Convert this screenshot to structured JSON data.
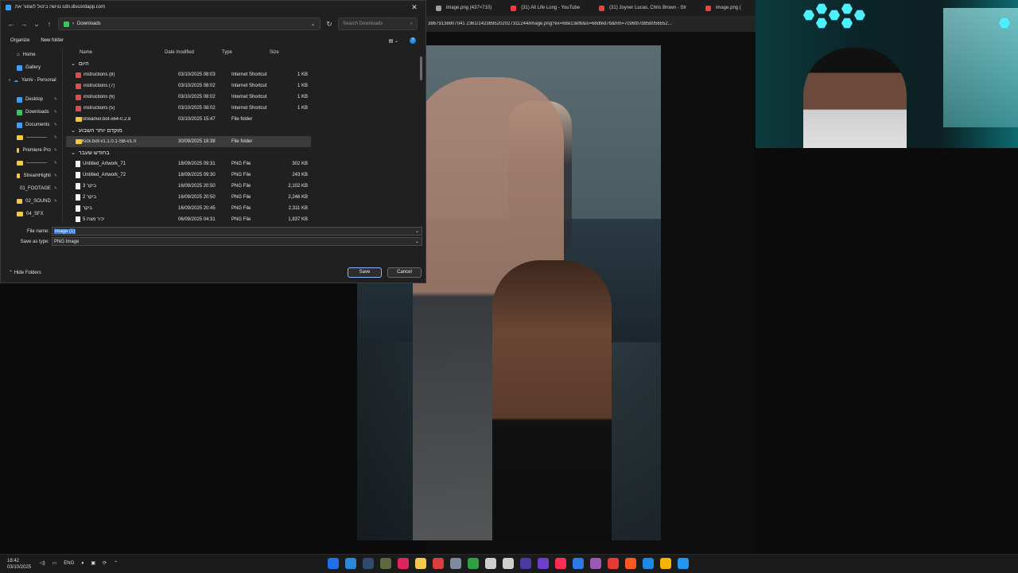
{
  "dialog": {
    "title": "נגישה ביטול לשמור את cdn.discordapp.com",
    "path": "Downloads",
    "search_placeholder": "Search Downloads",
    "toolbar": {
      "organize": "Organize",
      "new_folder": "New folder"
    },
    "columns": {
      "name": "Name",
      "date": "Date modified",
      "type": "Type",
      "size": "Size"
    },
    "sidebar": [
      {
        "label": "Home"
      },
      {
        "label": "Gallery"
      },
      {
        "label": "Yaniv - Personal"
      },
      {
        "label": "Desktop"
      },
      {
        "label": "Downloads"
      },
      {
        "label": "Documents"
      },
      {
        "label": "-------------"
      },
      {
        "label": "Premiere Pro"
      },
      {
        "label": "-------------"
      },
      {
        "label": "StreamHighli"
      },
      {
        "label": "01_FOOTAGE"
      },
      {
        "label": "02_SOUND"
      },
      {
        "label": "04_SFX"
      }
    ],
    "groups": [
      {
        "label": "היום",
        "rows": [
          {
            "name": "instructions (8)",
            "date": "03/10/2025 08:03",
            "type": "Internet Shortcut",
            "size": "1 KB",
            "icon": "shortcut"
          },
          {
            "name": "instructions (7)",
            "date": "03/10/2025 08:02",
            "type": "Internet Shortcut",
            "size": "1 KB",
            "icon": "shortcut"
          },
          {
            "name": "instructions (6)",
            "date": "03/10/2025 08:02",
            "type": "Internet Shortcut",
            "size": "1 KB",
            "icon": "shortcut"
          },
          {
            "name": "instructions (5)",
            "date": "03/10/2025 08:02",
            "type": "Internet Shortcut",
            "size": "1 KB",
            "icon": "shortcut"
          },
          {
            "name": "Streamer.bot-x64-0.2.8",
            "date": "03/10/2025 15:47",
            "type": "File folder",
            "size": "",
            "icon": "folder"
          }
        ]
      },
      {
        "label": "מוקדם יותר השבוע",
        "rows": [
          {
            "name": "Kick.bot-v1.1.0.1-SB-v1.0",
            "date": "30/09/2025 18:38",
            "type": "File folder",
            "size": "",
            "icon": "folder",
            "selected": true
          }
        ]
      },
      {
        "label": "בחודש שעבר",
        "rows": [
          {
            "name": "Untitled_Artwork_71",
            "date": "18/09/2025 09:31",
            "type": "PNG File",
            "size": "302 KB",
            "icon": "png"
          },
          {
            "name": "Untitled_Artwork_72",
            "date": "18/09/2025 09:30",
            "type": "PNG File",
            "size": "243 KB",
            "icon": "png"
          },
          {
            "name": "3 ביקר",
            "date": "16/09/2025 20:50",
            "type": "PNG File",
            "size": "2,102 KB",
            "icon": "png"
          },
          {
            "name": "2 ביקר",
            "date": "16/09/2025 20:50",
            "type": "PNG File",
            "size": "2,246 KB",
            "icon": "png"
          },
          {
            "name": "ביקר",
            "date": "16/09/2025 20:45",
            "type": "PNG File",
            "size": "2,311 KB",
            "icon": "png"
          },
          {
            "name": "5 יכיר מצח",
            "date": "06/09/2025 04:31",
            "type": "PNG File",
            "size": "1,837 KB",
            "icon": "png"
          }
        ]
      }
    ],
    "file_name_label": "File name:",
    "file_name_value": "image (1)",
    "save_type_label": "Save as type:",
    "save_type_value": "PNG Image",
    "hide_folders": "Hide Folders",
    "save": "Save",
    "cancel": "Cancel"
  },
  "browser": {
    "tabs": [
      {
        "label": "image.png (437×710)",
        "color": "#9aa0a6"
      },
      {
        "label": "(31) All Life Long - YouTube",
        "color": "#ff3b3b"
      },
      {
        "label": "(31) Joyner Lucas, Chris Brown - Str",
        "color": "#ff3b3b"
      },
      {
        "label": "image.png (",
        "color": "#ff3b3b"
      }
    ],
    "address": "38679138807041 2361/1423695202027311244/image.png?ex=68e13efb&is=68dfed7b&hm=7c96f87d85b056552..."
  },
  "taskbar": {
    "time": "18:42",
    "date": "03/10/2025",
    "language": "ENG",
    "apps": [
      "#1f6feb",
      "#2b88d8",
      "#2f4a6b",
      "#5b6b3d",
      "#e0245e",
      "#f2c94c",
      "#d93f3f",
      "#7d8aa0",
      "#2ea043",
      "#cfcfcf",
      "#cfcfcf",
      "#4a3aa8",
      "#6e40c9",
      "#ff2d55",
      "#2c7be5",
      "#9b59b6",
      "#e53935",
      "#ff5722",
      "#1e88e5",
      "#f4b400",
      "#2196f3"
    ]
  }
}
